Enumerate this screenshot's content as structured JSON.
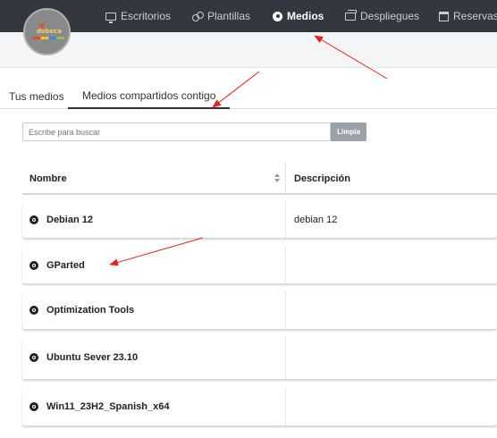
{
  "nav": {
    "items": [
      {
        "label": "Escritorios",
        "icon": "desktop-icon"
      },
      {
        "label": "Plantillas",
        "icon": "templates-icon"
      },
      {
        "label": "Medios",
        "icon": "media-disc-icon",
        "active": true
      },
      {
        "label": "Despliegues",
        "icon": "deployments-icon"
      },
      {
        "label": "Reservas",
        "icon": "calendar-icon"
      }
    ]
  },
  "logo": {
    "text": "dsbeca"
  },
  "tabs": [
    {
      "label": "Tus medios"
    },
    {
      "label": "Medios compartidos contigo",
      "active": true
    }
  ],
  "search": {
    "placeholder": "Escribe para buscar",
    "clear_label": "Limpia"
  },
  "table": {
    "headers": {
      "name": "Nombre",
      "description": "Descripción"
    },
    "rows": [
      {
        "name": "Debian 12",
        "description": "debian 12"
      },
      {
        "name": "GParted",
        "description": ""
      },
      {
        "name": "Optimization Tools",
        "description": ""
      },
      {
        "name": "Ubuntu Sever 23.10",
        "description": ""
      },
      {
        "name": "Win11_23H2_Spanish_x64",
        "description": ""
      }
    ]
  },
  "colors": {
    "nav_bg": "#32383e",
    "annotation_arrow": "#e8231c",
    "clear_button": "#9aa1a8"
  }
}
